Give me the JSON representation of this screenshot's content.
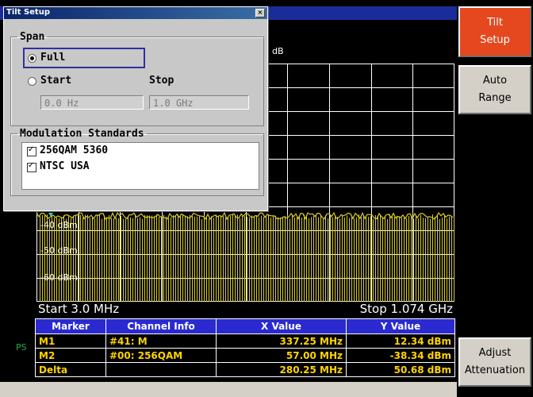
{
  "dialog": {
    "title": "Tilt Setup",
    "close": "×",
    "span": {
      "legend": "Span",
      "full_label": "Full",
      "start_label": "Start",
      "stop_label": "Stop",
      "start_value": "0.0 Hz",
      "stop_value": "1.0 GHz"
    },
    "modulation": {
      "legend": "Modulation Standards",
      "items": [
        {
          "label": "256QAM 5360",
          "checked": true
        },
        {
          "label": "NTSC USA",
          "checked": true
        }
      ]
    }
  },
  "graph": {
    "unit": "dB",
    "y_labels": [
      "-40 dBm",
      "-50 dBm",
      "-60 dBm"
    ],
    "start": "Start 3.0 MHz",
    "stop": "Stop 1.074 GHz"
  },
  "marker_table": {
    "headers": [
      "Marker",
      "Channel Info",
      "X Value",
      "Y Value"
    ],
    "rows": [
      [
        "M1",
        "#41: M",
        "337.25 MHz",
        "12.34 dBm"
      ],
      [
        "M2",
        "#00: 256QAM",
        "57.00 MHz",
        "-38.34 dBm"
      ],
      [
        "Delta",
        "",
        "280.25 MHz",
        "50.68 dBm"
      ]
    ]
  },
  "ps_label": "PS",
  "softkeys": [
    {
      "line1": "Tilt",
      "line2": "Setup",
      "active": true
    },
    {
      "line1": "Auto",
      "line2": "Range",
      "active": false
    },
    {
      "line1": "Adjust",
      "line2": "Attenuation",
      "active": false
    }
  ],
  "colors": {
    "trace": "#d8cc2e",
    "grid": "#ffffff",
    "active_softkey": "#e5481e",
    "table_header": "#2a2ad0",
    "table_text": "#ffd400",
    "title_bar": "#1a2c9a"
  }
}
